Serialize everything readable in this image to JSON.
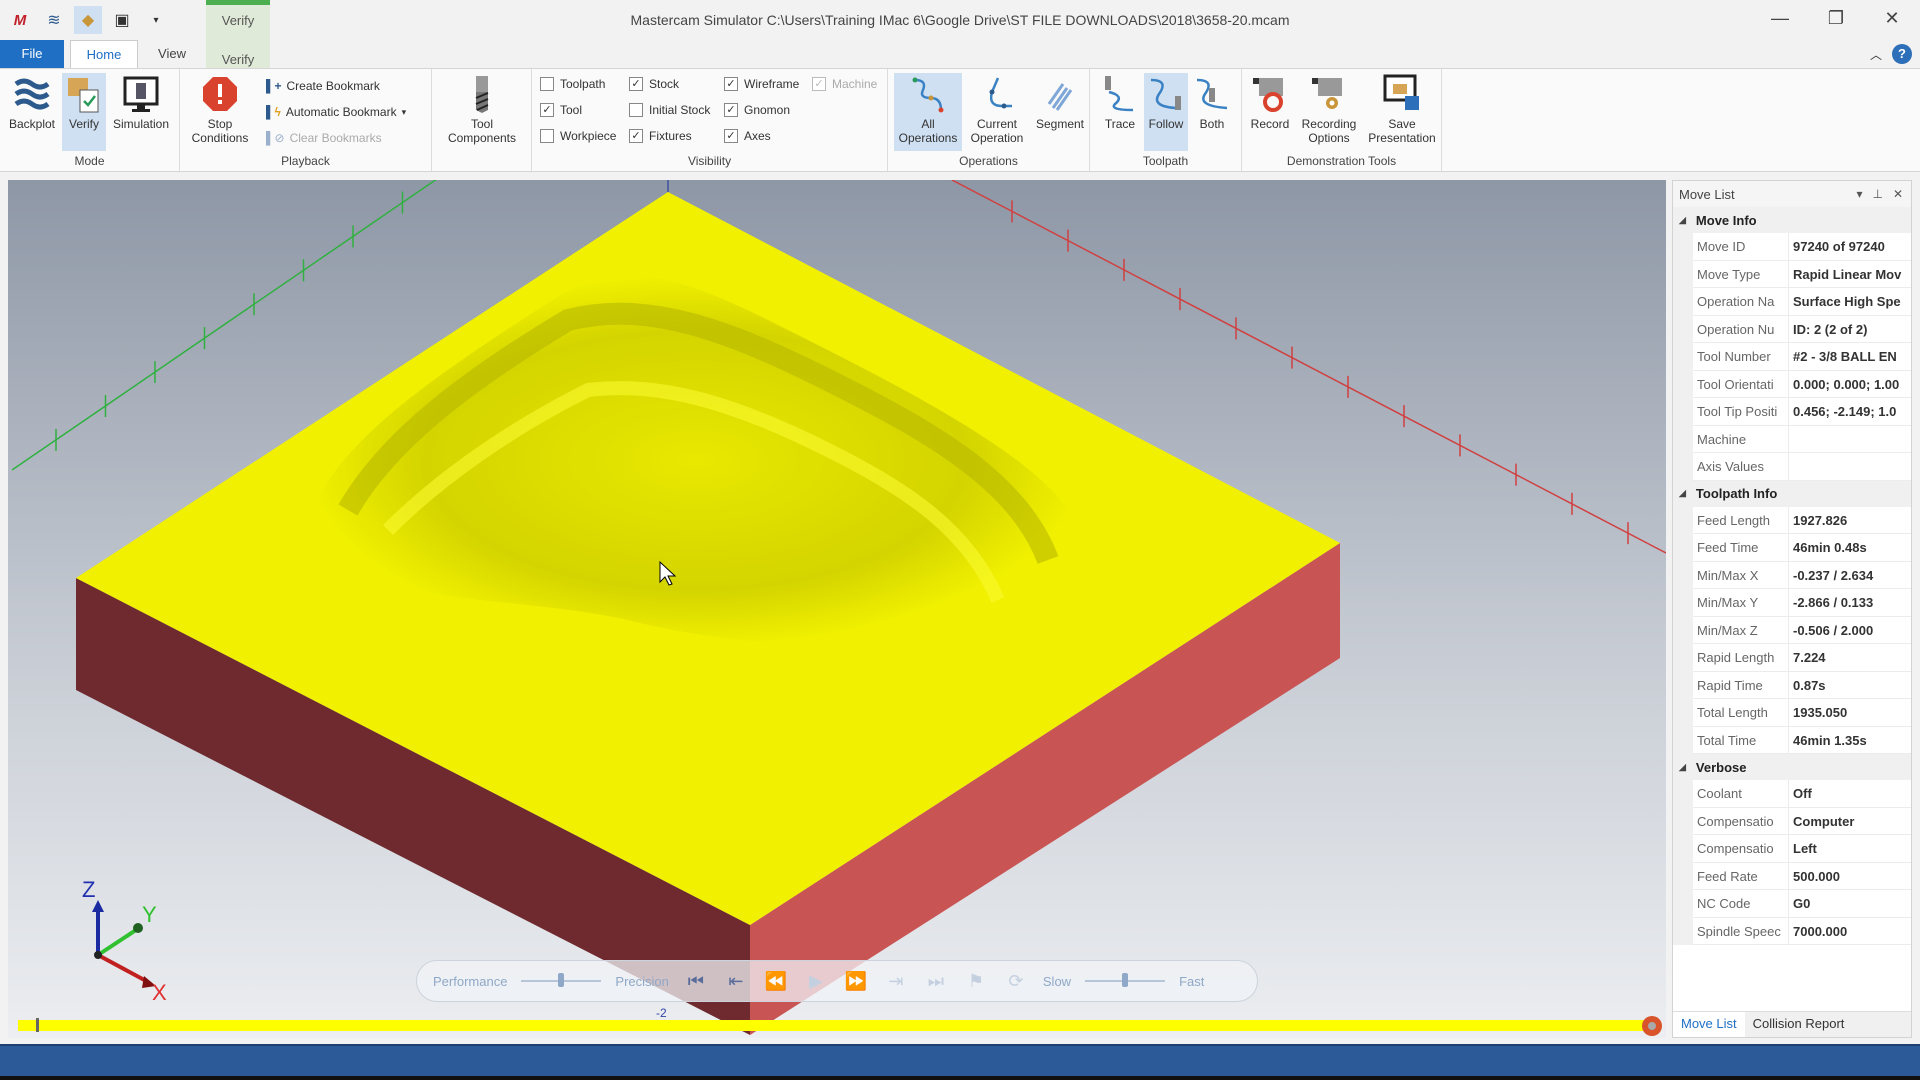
{
  "app": {
    "title": "Mastercam Simulator  C:\\Users\\Training IMac 6\\Google Drive\\ST FILE DOWNLOADS\\2018\\3658-20.mcam",
    "context_tab_group": "Verify",
    "quick_access": [
      "mastercam-logo-icon",
      "backplot-icon",
      "verify-icon",
      "simulation-icon",
      "customize-qat-icon"
    ],
    "window_buttons": {
      "minimize": "—",
      "restore": "❐",
      "close": "✕"
    }
  },
  "tabs": {
    "file": "File",
    "home": "Home",
    "view": "View",
    "verify": "Verify",
    "active": "Home"
  },
  "ribbon": {
    "mode": {
      "label": "Mode",
      "buttons": [
        {
          "label": "Backplot",
          "selected": false
        },
        {
          "label": "Verify",
          "selected": true
        },
        {
          "label": "Simulation",
          "selected": false
        }
      ]
    },
    "playback": {
      "label": "Playback",
      "stop_conditions": "Stop\nConditions",
      "create_bookmark": "Create Bookmark",
      "automatic_bookmark": "Automatic Bookmark",
      "clear_bookmarks": "Clear Bookmarks"
    },
    "tool_components": {
      "label": "Tool\nComponents"
    },
    "visibility": {
      "label": "Visibility",
      "items": [
        {
          "label": "Toolpath",
          "checked": false,
          "enabled": true
        },
        {
          "label": "Tool",
          "checked": true,
          "enabled": true
        },
        {
          "label": "Workpiece",
          "checked": false,
          "enabled": true
        },
        {
          "label": "Stock",
          "checked": true,
          "enabled": true
        },
        {
          "label": "Initial Stock",
          "checked": false,
          "enabled": true
        },
        {
          "label": "Fixtures",
          "checked": true,
          "enabled": true
        },
        {
          "label": "Wireframe",
          "checked": true,
          "enabled": true
        },
        {
          "label": "Gnomon",
          "checked": true,
          "enabled": true
        },
        {
          "label": "Axes",
          "checked": true,
          "enabled": true
        },
        {
          "label": "Machine",
          "checked": true,
          "enabled": false
        }
      ]
    },
    "operations": {
      "label": "Operations",
      "buttons": [
        {
          "label": "All\nOperations",
          "selected": true
        },
        {
          "label": "Current\nOperation",
          "selected": false
        },
        {
          "label": "Segment",
          "selected": false
        }
      ]
    },
    "toolpath": {
      "label": "Toolpath",
      "buttons": [
        {
          "label": "Trace",
          "selected": false
        },
        {
          "label": "Follow",
          "selected": true
        },
        {
          "label": "Both",
          "selected": false
        }
      ]
    },
    "demo": {
      "label": "Demonstration Tools",
      "buttons": [
        {
          "label": "Record"
        },
        {
          "label": "Recording\nOptions"
        },
        {
          "label": "Save\nPresentation"
        }
      ]
    }
  },
  "viewport": {
    "gnomon": {
      "x": "X",
      "y": "Y",
      "z": "Z"
    },
    "axis_label": "-2",
    "colors": {
      "stock_top": "#f0f000",
      "stock_left": "#6e2a2e",
      "stock_right": "#c95454",
      "x_axis": "#d04040",
      "y_axis": "#30b040"
    }
  },
  "playback_bar": {
    "performance": "Performance",
    "precision": "Precision",
    "slow": "Slow",
    "fast": "Fast",
    "quality_slider": 0.5,
    "speed_slider": 0.5,
    "buttons": [
      "skip-to-start",
      "step-back",
      "rewind",
      "play",
      "fast-forward",
      "step-forward",
      "skip-to-end",
      "add-bookmark",
      "loop"
    ]
  },
  "timeline": {
    "progress": 1.0
  },
  "move_list": {
    "title": "Move List",
    "sections": [
      {
        "name": "Move Info",
        "rows": [
          {
            "k": "Move ID",
            "v": "97240 of 97240"
          },
          {
            "k": "Move Type",
            "v": "Rapid Linear Mov"
          },
          {
            "k": "Operation Na",
            "v": "Surface High Spe"
          },
          {
            "k": "Operation Nu",
            "v": "ID: 2 (2 of 2)"
          },
          {
            "k": "Tool Number",
            "v": "#2 - 3/8 BALL EN"
          },
          {
            "k": "Tool Orientati",
            "v": "0.000; 0.000; 1.00"
          },
          {
            "k": "Tool Tip Positi",
            "v": "0.456; -2.149; 1.0"
          },
          {
            "k": "Machine",
            "v": ""
          },
          {
            "k": "Axis Values",
            "v": ""
          }
        ]
      },
      {
        "name": "Toolpath Info",
        "rows": [
          {
            "k": "Feed Length",
            "v": "1927.826"
          },
          {
            "k": "Feed Time",
            "v": "46min 0.48s"
          },
          {
            "k": "Min/Max X",
            "v": "-0.237 / 2.634"
          },
          {
            "k": "Min/Max Y",
            "v": "-2.866 / 0.133"
          },
          {
            "k": "Min/Max Z",
            "v": "-0.506 / 2.000"
          },
          {
            "k": "Rapid Length",
            "v": "7.224"
          },
          {
            "k": "Rapid Time",
            "v": "0.87s"
          },
          {
            "k": "Total Length",
            "v": "1935.050"
          },
          {
            "k": "Total Time",
            "v": "46min 1.35s"
          }
        ]
      },
      {
        "name": "Verbose",
        "rows": [
          {
            "k": "Coolant",
            "v": "Off"
          },
          {
            "k": "Compensatio",
            "v": "Computer"
          },
          {
            "k": "Compensatio",
            "v": "Left"
          },
          {
            "k": "Feed Rate",
            "v": "500.000"
          },
          {
            "k": "NC Code",
            "v": "G0"
          },
          {
            "k": "Spindle Speec",
            "v": "7000.000"
          }
        ]
      }
    ],
    "tabs": [
      {
        "label": "Move List",
        "active": true
      },
      {
        "label": "Collision Report",
        "active": false
      }
    ]
  }
}
